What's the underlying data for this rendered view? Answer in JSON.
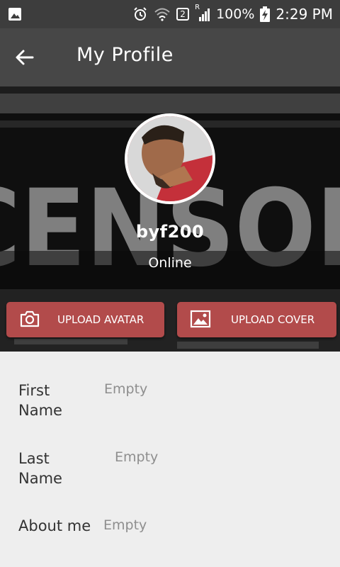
{
  "status_bar": {
    "sim_slot": "2",
    "roaming": "R",
    "battery": "100%",
    "time": "2:29 PM"
  },
  "app_bar": {
    "title": "My Profile"
  },
  "profile": {
    "username": "byf200",
    "status": "Online",
    "cover_text": "CENSOR"
  },
  "actions": {
    "upload_avatar": "UPLOAD AVATAR",
    "upload_cover": "UPLOAD COVER"
  },
  "fields": [
    {
      "label_line1": "First",
      "label_line2": "Name",
      "value": "Empty"
    },
    {
      "label_line1": "Last",
      "label_line2": "Name",
      "value": "Empty"
    },
    {
      "label_line1": "About me",
      "label_line2": "",
      "value": "Empty"
    }
  ],
  "colors": {
    "status_bar": "#3d3d3d",
    "app_bar": "#474747",
    "button": "#b24b4b",
    "details_bg": "#eeeeee"
  },
  "icons": [
    "image-icon",
    "alarm-icon",
    "wifi-icon",
    "signal-icon",
    "battery-charging-icon",
    "back-arrow-icon",
    "camera-icon",
    "picture-icon"
  ]
}
